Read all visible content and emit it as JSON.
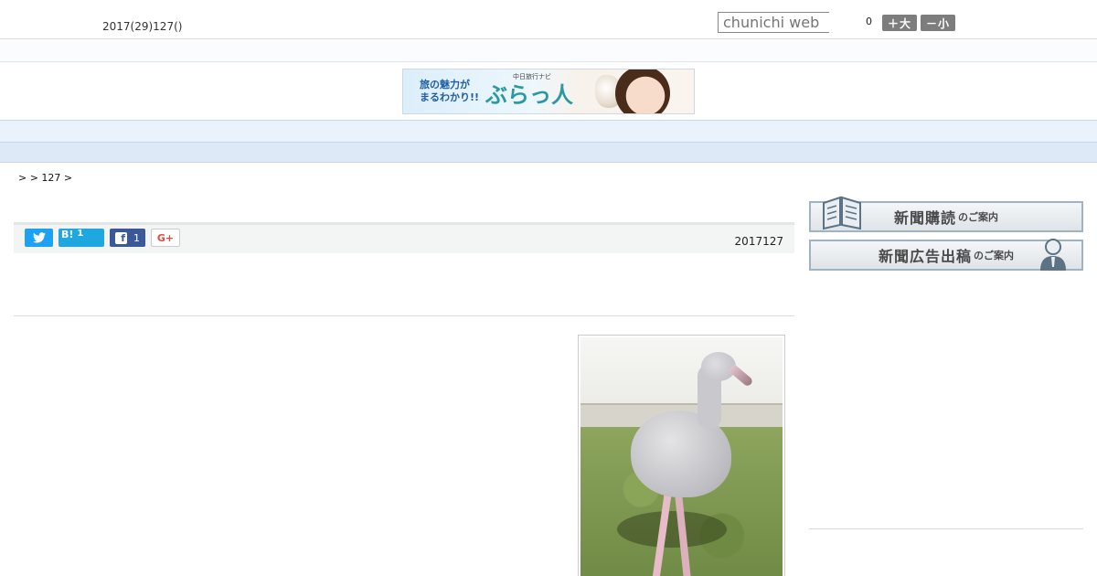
{
  "header": {
    "date": "2017(29)127()",
    "search_placeholder": "chunichi web",
    "counter": "0",
    "font_larger_label": "＋大",
    "font_smaller_label": "－小"
  },
  "banner": {
    "tagline": "旅の魅力が\nまるわかり!!",
    "brand_sub": "中日旅行ナビ",
    "brand": "ぶらっ人"
  },
  "nav": {
    "items": [
      "  ",
      "  ",
      "  ",
      "  ",
      "  ",
      "  ",
      "  ",
      "  ",
      "  "
    ]
  },
  "breadcrumb": ">  > 127 >",
  "share": {
    "twitter_count": "",
    "hatena_label": "B!",
    "hatena_count": "1",
    "facebook_count": "1",
    "gplus_label": "G+"
  },
  "article": {
    "pubdate": "2017127"
  },
  "sidebar": {
    "subscribe_label": "新聞購読",
    "subscribe_suffix": "のご案内",
    "advertise_label": "新聞広告出稿",
    "advertise_suffix": "のご案内"
  },
  "colors": {
    "nav_bg": "#eaf2fb",
    "twitter": "#1da1f2",
    "hatena": "#1fa8e0",
    "facebook": "#3b5998",
    "gplus": "#dd4b39"
  }
}
